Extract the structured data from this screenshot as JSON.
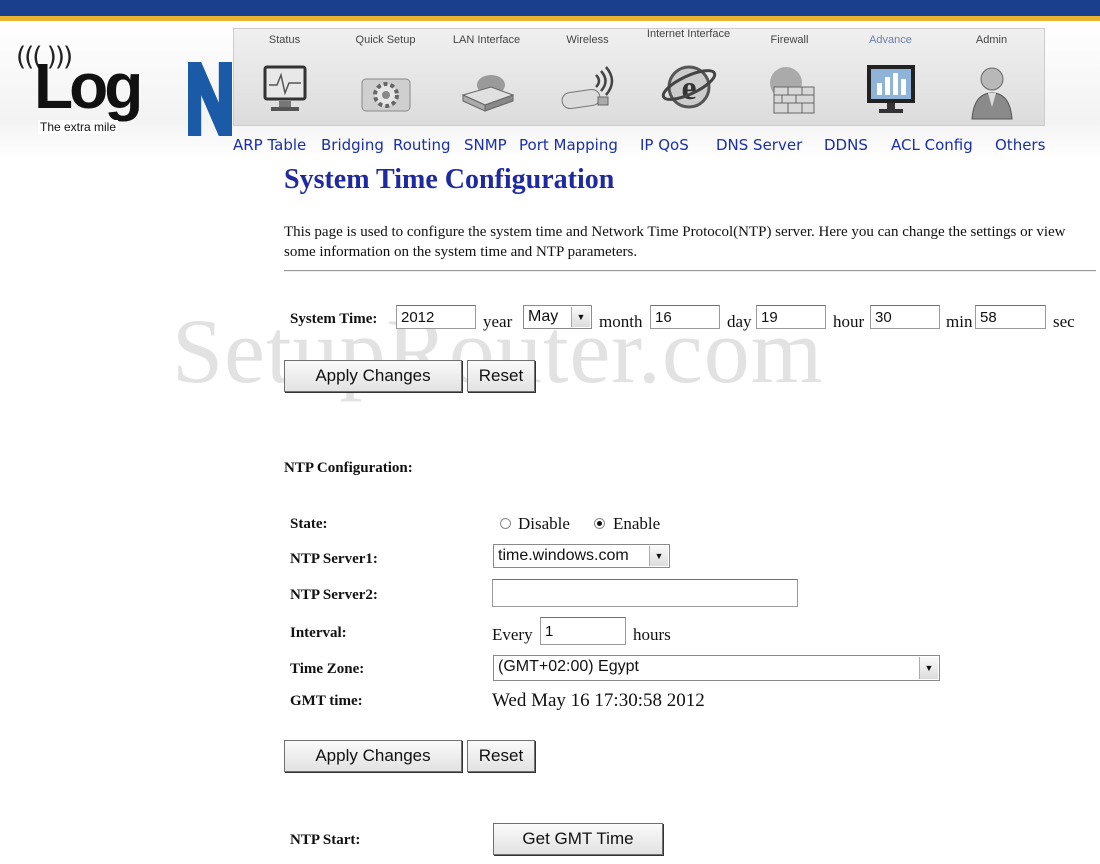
{
  "logo": {
    "waves": "((( )))",
    "word": "Log",
    "tagline": "The extra mile"
  },
  "tabs": [
    {
      "label": "Status",
      "icon": "monitor-icon"
    },
    {
      "label": "Quick Setup",
      "icon": "gears-icon"
    },
    {
      "label": "LAN Interface",
      "icon": "router-icon"
    },
    {
      "label": "Wireless",
      "icon": "usb-wireless-icon"
    },
    {
      "label": "Internet Interface",
      "icon": "internet-explorer-icon"
    },
    {
      "label": "Firewall",
      "icon": "firewall-icon"
    },
    {
      "label": "Advance",
      "icon": "advanced-monitor-icon",
      "active": true
    },
    {
      "label": "Admin",
      "icon": "admin-user-icon"
    }
  ],
  "subnav": [
    "ARP Table",
    "Bridging",
    "Routing",
    "SNMP",
    "Port Mapping",
    "IP QoS",
    "DNS Server",
    "DDNS",
    "ACL Config",
    "Others"
  ],
  "page": {
    "title": "System Time Configuration",
    "description": "This page is used to configure the system time and Network Time Protocol(NTP) server. Here you can change the settings or view some information on the system time and NTP parameters.",
    "watermark": "SetupRouter.com"
  },
  "system_time": {
    "label": "System Time:",
    "year_value": "2012",
    "year_label": "year",
    "month_value": "May",
    "month_label": "month",
    "day_value": "16",
    "day_label": "day",
    "hour_value": "19",
    "hour_label": "hour",
    "min_value": "30",
    "min_label": "min",
    "sec_value": "58",
    "sec_label": "sec",
    "apply_label": "Apply Changes",
    "reset_label": "Reset"
  },
  "ntp": {
    "section_label": "NTP Configuration:",
    "state_label": "State:",
    "disable_label": "Disable",
    "enable_label": "Enable",
    "state_selected": "Enable",
    "server1_label": "NTP Server1:",
    "server1_value": "time.windows.com",
    "server2_label": "NTP Server2:",
    "server2_value": "",
    "interval_label": "Interval:",
    "interval_prefix": "Every",
    "interval_value": "1",
    "interval_unit": "hours",
    "timezone_label": "Time Zone:",
    "timezone_value": "(GMT+02:00) Egypt",
    "gmt_label": "GMT time:",
    "gmt_value": "Wed May 16 17:30:58 2012",
    "apply_label": "Apply Changes",
    "reset_label": "Reset",
    "start_label": "NTP Start:",
    "get_gmt_label": "Get GMT Time"
  }
}
